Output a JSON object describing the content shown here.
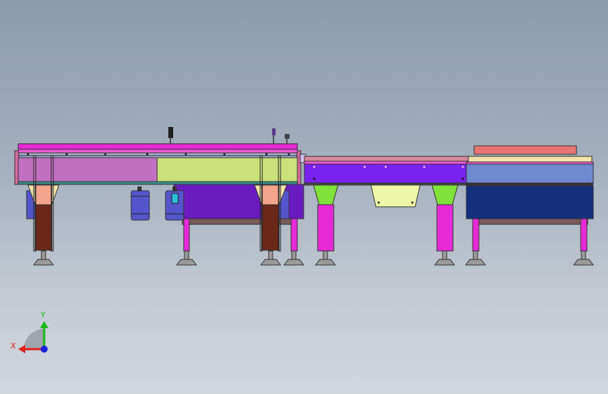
{
  "axes": {
    "x_label": "X",
    "y_label": "Y",
    "x_color": "#e0201a",
    "y_color": "#18b818",
    "z_color": "#1a22d8"
  },
  "colors": {
    "frame_magenta": "#e62ad6",
    "rail_pink": "#f25ad8",
    "panel_mauve": "#c070c0",
    "panel_lime": "#cbe07a",
    "purple_box": "#6a1bbf",
    "violet_band": "#7a22f0",
    "blue_light": "#6f8ad0",
    "blue_dark": "#142f7c",
    "leg_brown": "#6b2818",
    "leg_salmon": "#f4a48c",
    "green_bracket": "#7fe13a",
    "yellow_pale": "#eef7a8",
    "motor_blue": "#5555cc",
    "top_plate": "#e87474",
    "cream": "#f3e3a8"
  }
}
